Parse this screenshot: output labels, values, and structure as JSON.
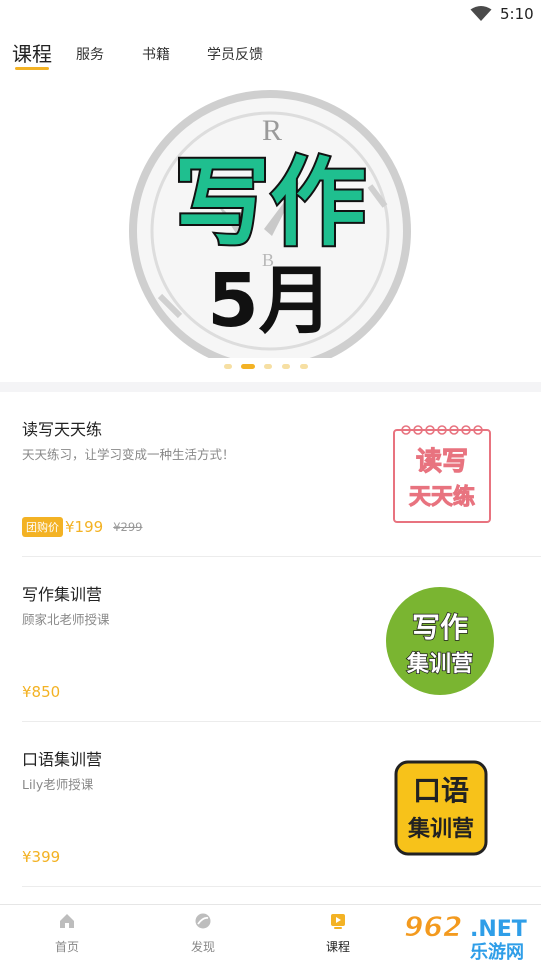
{
  "status_bar": {
    "time": "5:10",
    "wifi_icon": "wifi-icon"
  },
  "tabs": [
    {
      "label": "课程",
      "active": true
    },
    {
      "label": "服务",
      "active": false
    },
    {
      "label": "书籍",
      "active": false
    },
    {
      "label": "学员反馈",
      "active": false
    }
  ],
  "banner": {
    "line1": "写作",
    "line2": "5月",
    "clock_letters": [
      "R",
      "B"
    ],
    "carousel_count": 5,
    "carousel_active": 1
  },
  "courses": [
    {
      "title": "读写天天练",
      "subtitle": "天天练习，让学习变成一种生活方式！",
      "badge": "团购价",
      "price": "¥199",
      "old_price": "¥299",
      "thumb_line1": "读写",
      "thumb_line2": "天天练"
    },
    {
      "title": "写作集训营",
      "subtitle": "顾家北老师授课",
      "price": "¥850",
      "thumb_line1": "写作",
      "thumb_line2": "集训营"
    },
    {
      "title": "口语集训营",
      "subtitle": "Lily老师授课",
      "price": "¥399",
      "thumb_line1": "口语",
      "thumb_line2": "集训营"
    }
  ],
  "nav": [
    {
      "label": "首页",
      "icon": "home-icon",
      "active": false
    },
    {
      "label": "发现",
      "icon": "discover-icon",
      "active": false
    },
    {
      "label": "课程",
      "icon": "course-icon",
      "active": true
    }
  ],
  "watermark": {
    "number": "962",
    "suffix": ".NET",
    "name": "乐游网"
  },
  "colors": {
    "accent": "#f3b224",
    "green_text": "#1fbf8f",
    "thumb_green": "#7ab531",
    "thumb_yellow": "#f7c21a",
    "thumb_pink": "#e8737f"
  }
}
